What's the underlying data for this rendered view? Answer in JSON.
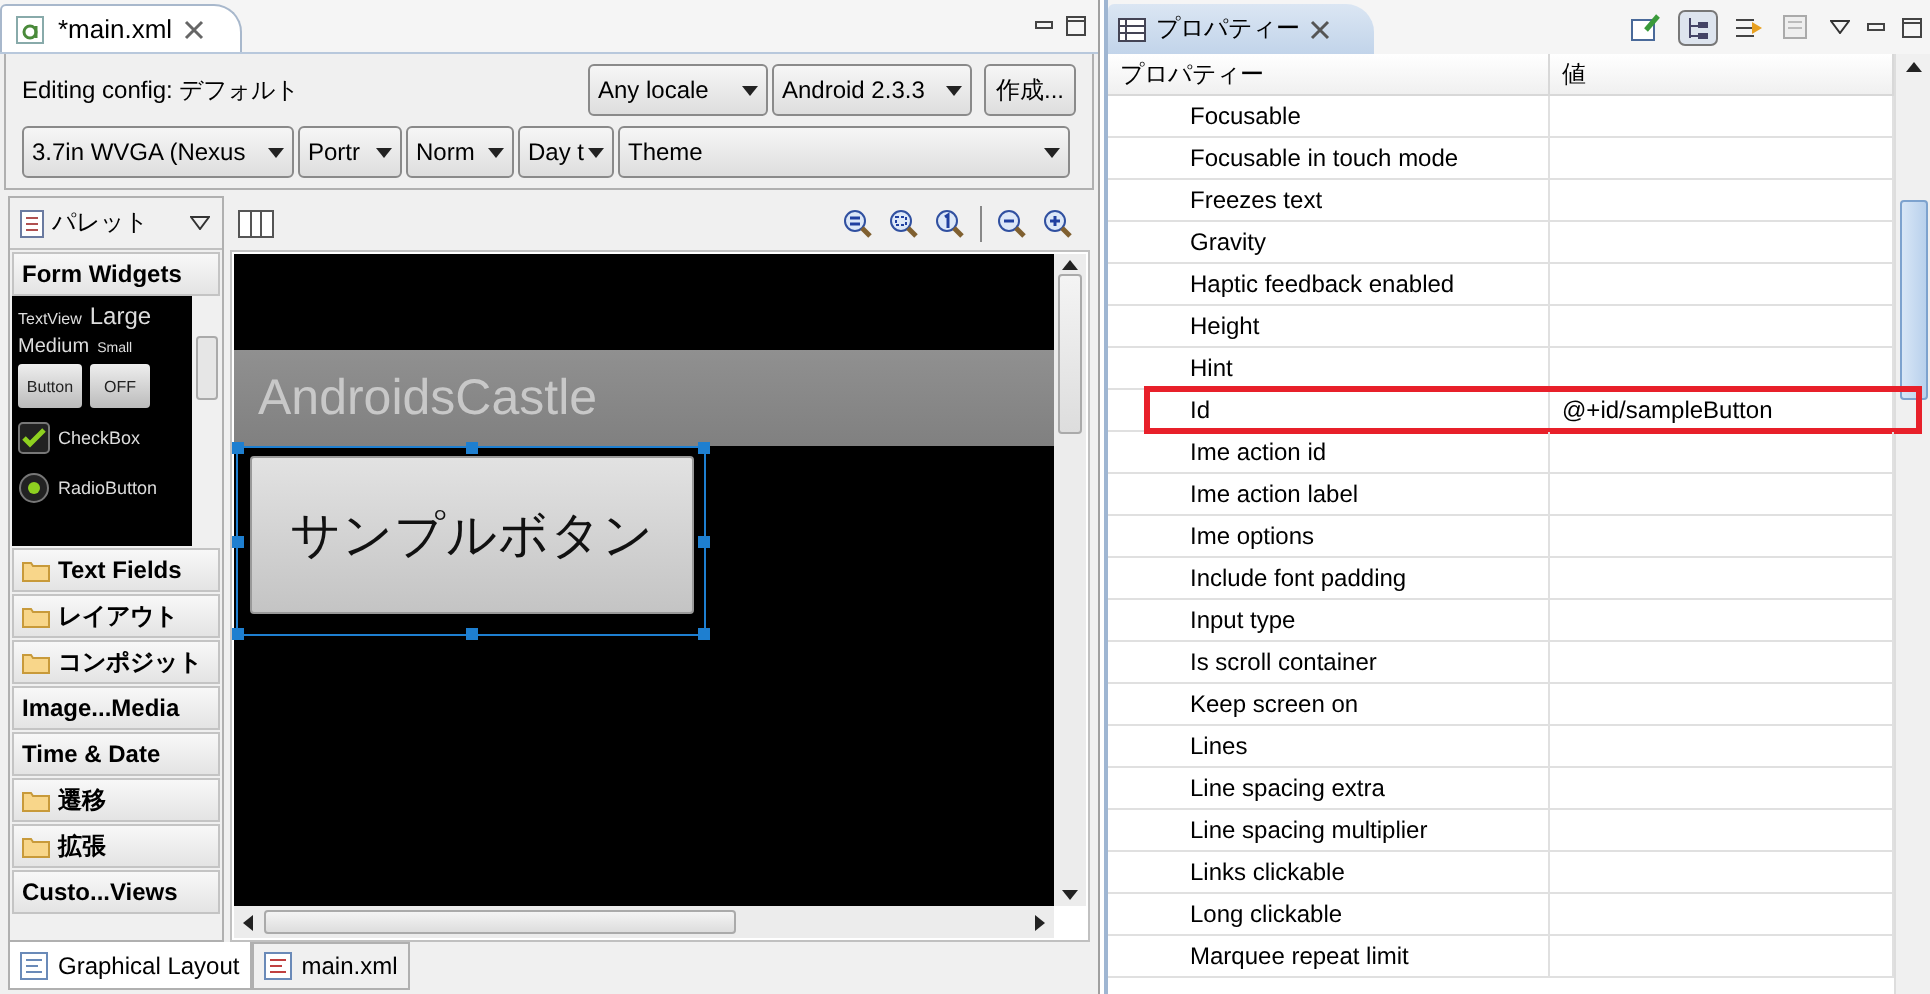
{
  "editor": {
    "tab": {
      "title": "*main.xml"
    },
    "config_label": "Editing config: デフォルト",
    "config_row1": [
      {
        "kind": "dropdown",
        "label": "Any locale"
      },
      {
        "kind": "dropdown",
        "label": "Android 2.3.3"
      },
      {
        "kind": "button",
        "label": "作成..."
      }
    ],
    "config_row2": [
      {
        "label": "3.7in WVGA (Nexus"
      },
      {
        "label": "Portr"
      },
      {
        "label": "Norm"
      },
      {
        "label": "Day t"
      },
      {
        "label": "Theme"
      }
    ]
  },
  "palette": {
    "title": "パレット",
    "preview": {
      "textview": "TextView",
      "large": "Large",
      "medium": "Medium",
      "small": "Small",
      "button": "Button",
      "toggle": "OFF",
      "checkbox": {
        "label": "CheckBox",
        "checked": true
      },
      "radio": {
        "label": "RadioButton",
        "selected": true
      }
    },
    "sections": [
      {
        "label": "Form Widgets",
        "folder": false,
        "expanded": true
      },
      {
        "label": "Text Fields",
        "folder": true,
        "expanded": false
      },
      {
        "label": "レイアウト",
        "folder": true,
        "expanded": false
      },
      {
        "label": "コンポジット",
        "folder": true,
        "expanded": false
      },
      {
        "label": "Image...Media",
        "folder": false,
        "expanded": false
      },
      {
        "label": "Time & Date",
        "folder": false,
        "expanded": false
      },
      {
        "label": "遷移",
        "folder": true,
        "expanded": false
      },
      {
        "label": "拡張",
        "folder": true,
        "expanded": false
      },
      {
        "label": "Custo...Views",
        "folder": false,
        "expanded": false
      }
    ]
  },
  "canvas": {
    "app_title": "AndroidsCastle",
    "button": {
      "label": "サンプルボタン",
      "selected": true
    }
  },
  "bottom_tabs": [
    {
      "label": "Graphical Layout",
      "selected": true
    },
    {
      "label": "main.xml",
      "selected": false
    }
  ],
  "properties": {
    "title": "プロパティー",
    "columns": [
      "プロパティー",
      "値"
    ],
    "rows": [
      {
        "name": "Focusable",
        "highlighted": false
      },
      {
        "name": "Focusable in touch mode",
        "highlighted": false
      },
      {
        "name": "Freezes text",
        "highlighted": false
      },
      {
        "name": "Gravity",
        "highlighted": false
      },
      {
        "name": "Haptic feedback enabled",
        "highlighted": false
      },
      {
        "name": "Height",
        "highlighted": false
      },
      {
        "name": "Hint",
        "highlighted": false
      },
      {
        "name": "Id",
        "value": "@+id/sampleButton",
        "highlighted": true
      },
      {
        "name": "Ime action id",
        "highlighted": false
      },
      {
        "name": "Ime action label",
        "highlighted": false
      },
      {
        "name": "Ime options",
        "highlighted": false
      },
      {
        "name": "Include font padding",
        "highlighted": false
      },
      {
        "name": "Input type",
        "highlighted": false
      },
      {
        "name": "Is scroll container",
        "highlighted": false
      },
      {
        "name": "Keep screen on",
        "highlighted": false
      },
      {
        "name": "Lines",
        "highlighted": false
      },
      {
        "name": "Line spacing extra",
        "highlighted": false
      },
      {
        "name": "Line spacing multiplier",
        "highlighted": false
      },
      {
        "name": "Links clickable",
        "highlighted": false
      },
      {
        "name": "Long clickable",
        "highlighted": false
      },
      {
        "name": "Marquee repeat limit",
        "highlighted": false
      }
    ]
  }
}
